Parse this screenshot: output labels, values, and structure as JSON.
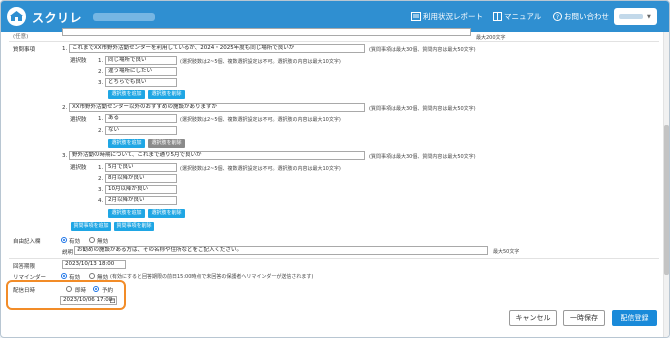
{
  "header": {
    "app_title": "スクリレ",
    "nav": [
      "利用状況レポート",
      "マニュアル",
      "お問い合わせ"
    ]
  },
  "top_note": "最大200文字",
  "top_label": "(任意)",
  "questions": {
    "label": "質問事項",
    "q1": {
      "num": "1.",
      "text": "これまでXX市野外活動センターを利用しているが、2024・2025年度も同じ場所で良いか",
      "note": "(質問事項は最大30個、質問内容は最大50文字)",
      "options_label": "選択肢",
      "options": [
        "同じ場所で良い",
        "違う場所にしたい",
        "どちらでも良い"
      ],
      "options_note": "(選択肢数は2~5個、複数選択設定は不可。選択肢の内容は最大10文字)",
      "add": "選択肢を追加",
      "remove": "選択肢を削除"
    },
    "q2": {
      "num": "2.",
      "text": "XX市野外活動センター以外のおすすめの施設がありますか",
      "note": "(質問事項は最大30個、質問内容は最大50文字)",
      "options_label": "選択肢",
      "options": [
        "ある",
        "ない"
      ],
      "options_note": "(選択肢数は2~5個、複数選択設定は不可。選択肢の内容は最大10文字)",
      "add": "選択肢を追加",
      "remove": "選択肢を削除"
    },
    "q3": {
      "num": "3.",
      "text": "野外活動の時期について、これまで通り5月で良いか",
      "note": "(質問事項は最大30個、質問内容は最大50文字)",
      "options_label": "選択肢",
      "options": [
        "5月で良い",
        "8月以降が良い",
        "10月以降が良い",
        "2月以降が良い"
      ],
      "options_note": "(選択肢数は2~5個、複数選択設定は不可。選択肢の内容は最大10文字)",
      "add": "選択肢を追加",
      "remove": "選択肢を削除"
    },
    "add_question": "質問事項を追加",
    "remove_question": "質問事項を削除"
  },
  "free_text": {
    "label": "自由記入欄",
    "opt_yes": "有効",
    "opt_no": "無効",
    "desc_label": "説明",
    "desc_value": "お勧めの施設がある方は、その名称や住所などをご記入ください。",
    "note": "最大50文字"
  },
  "deadline": {
    "label": "回答期限",
    "value": "2023/10/13 18:00"
  },
  "reminder": {
    "label": "リマインダー",
    "opt_yes": "有効",
    "opt_no": "無効",
    "note": "(有効にすると回答期限の前日15:00時点で未回答の保護者へリマインダーが送信されます)"
  },
  "delivery": {
    "label": "配信日時",
    "opt_now": "即時",
    "opt_schedule": "予約",
    "value": "2023/10/06 17:08"
  },
  "footer": {
    "cancel": "キャンセル",
    "save_draft": "一時保存",
    "deliver": "配信登録"
  }
}
